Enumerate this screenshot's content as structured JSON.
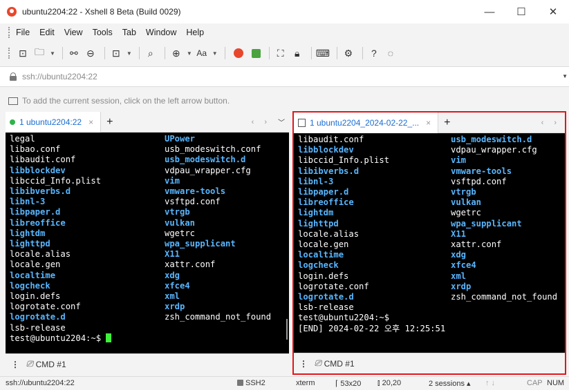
{
  "window": {
    "title": "ubuntu2204:22 - Xshell 8 Beta (Build 0029)",
    "controls": [
      "—",
      "☐",
      "✕"
    ]
  },
  "menu": [
    "File",
    "Edit",
    "View",
    "Tools",
    "Tab",
    "Window",
    "Help"
  ],
  "address": {
    "value": "ssh://ubuntu2204:22"
  },
  "hint": "To add the current session, click on the left arrow button.",
  "left_pane": {
    "tab_label": "1 ubuntu2204:22",
    "tab_close": "×",
    "tab_add": "+",
    "arrows": "‹ ›",
    "col1": [
      {
        "t": "legal",
        "c": "n"
      },
      {
        "t": "libao.conf",
        "c": "n"
      },
      {
        "t": "libaudit.conf",
        "c": "n"
      },
      {
        "t": "libblockdev",
        "c": "h"
      },
      {
        "t": "libccid_Info.plist",
        "c": "n"
      },
      {
        "t": "libibverbs.d",
        "c": "h"
      },
      {
        "t": "libnl-3",
        "c": "h"
      },
      {
        "t": "libpaper.d",
        "c": "h"
      },
      {
        "t": "libreoffice",
        "c": "h"
      },
      {
        "t": "lightdm",
        "c": "h"
      },
      {
        "t": "lighttpd",
        "c": "h"
      },
      {
        "t": "locale.alias",
        "c": "n"
      },
      {
        "t": "locale.gen",
        "c": "n"
      },
      {
        "t": "localtime",
        "c": "h"
      },
      {
        "t": "logcheck",
        "c": "h"
      },
      {
        "t": "login.defs",
        "c": "n"
      },
      {
        "t": "logrotate.conf",
        "c": "n"
      },
      {
        "t": "logrotate.d",
        "c": "h"
      },
      {
        "t": "lsb-release",
        "c": "n"
      }
    ],
    "col2": [
      {
        "t": "UPower",
        "c": "h"
      },
      {
        "t": "usb_modeswitch.conf",
        "c": "n"
      },
      {
        "t": "usb_modeswitch.d",
        "c": "h"
      },
      {
        "t": "vdpau_wrapper.cfg",
        "c": "n"
      },
      {
        "t": "vim",
        "c": "h"
      },
      {
        "t": "vmware-tools",
        "c": "h"
      },
      {
        "t": "vsftpd.conf",
        "c": "n"
      },
      {
        "t": "vtrgb",
        "c": "h"
      },
      {
        "t": "vulkan",
        "c": "h"
      },
      {
        "t": "wgetrc",
        "c": "n"
      },
      {
        "t": "wpa_supplicant",
        "c": "h"
      },
      {
        "t": "X11",
        "c": "h"
      },
      {
        "t": "xattr.conf",
        "c": "n"
      },
      {
        "t": "xdg",
        "c": "h"
      },
      {
        "t": "xfce4",
        "c": "h"
      },
      {
        "t": "xml",
        "c": "h"
      },
      {
        "t": "xrdp",
        "c": "h"
      },
      {
        "t": "zsh_command_not_found",
        "c": "n"
      }
    ],
    "prompt": "test@ubuntu2204:~$ ",
    "cmd_label": "CMD #1"
  },
  "right_pane": {
    "tab_label": "1 ubuntu2204_2024-02-22_...",
    "tab_close": "×",
    "tab_add": "+",
    "arrows": "‹ ›",
    "col1": [
      {
        "t": "libaudit.conf",
        "c": "n"
      },
      {
        "t": "libblockdev",
        "c": "h"
      },
      {
        "t": "libccid_Info.plist",
        "c": "n"
      },
      {
        "t": "libibverbs.d",
        "c": "h"
      },
      {
        "t": "libnl-3",
        "c": "h"
      },
      {
        "t": "libpaper.d",
        "c": "h"
      },
      {
        "t": "libreoffice",
        "c": "h"
      },
      {
        "t": "lightdm",
        "c": "h"
      },
      {
        "t": "lighttpd",
        "c": "h"
      },
      {
        "t": "locale.alias",
        "c": "n"
      },
      {
        "t": "locale.gen",
        "c": "n"
      },
      {
        "t": "localtime",
        "c": "h"
      },
      {
        "t": "logcheck",
        "c": "h"
      },
      {
        "t": "login.defs",
        "c": "n"
      },
      {
        "t": "logrotate.conf",
        "c": "n"
      },
      {
        "t": "logrotate.d",
        "c": "h"
      },
      {
        "t": "lsb-release",
        "c": "n"
      },
      {
        "t": "test@ubuntu2204:~$",
        "c": "n"
      },
      {
        "t": "[END] 2024-02-22 오후 12:25:51",
        "c": "n"
      }
    ],
    "col2": [
      {
        "t": "usb_modeswitch.d",
        "c": "h"
      },
      {
        "t": "vdpau_wrapper.cfg",
        "c": "n"
      },
      {
        "t": "vim",
        "c": "h"
      },
      {
        "t": "vmware-tools",
        "c": "h"
      },
      {
        "t": "vsftpd.conf",
        "c": "n"
      },
      {
        "t": "vtrgb",
        "c": "h"
      },
      {
        "t": "vulkan",
        "c": "h"
      },
      {
        "t": "wgetrc",
        "c": "n"
      },
      {
        "t": "wpa_supplicant",
        "c": "h"
      },
      {
        "t": "X11",
        "c": "h"
      },
      {
        "t": "xattr.conf",
        "c": "n"
      },
      {
        "t": "xdg",
        "c": "h"
      },
      {
        "t": "xfce4",
        "c": "h"
      },
      {
        "t": "xml",
        "c": "h"
      },
      {
        "t": "xrdp",
        "c": "h"
      },
      {
        "t": "zsh_command_not_found",
        "c": "n"
      }
    ],
    "cmd_label": "CMD #1"
  },
  "status": {
    "address": "ssh://ubuntu2204:22",
    "protocol": "SSH2",
    "term": "xterm",
    "size": "53x20",
    "cursor": "20,20",
    "sessions": "2 sessions",
    "caps": "CAP",
    "num": "NUM"
  },
  "colors": {
    "highlight_border": "#e0151a",
    "term_dir": "#58b6ff",
    "term_cursor": "#3ff03a"
  }
}
